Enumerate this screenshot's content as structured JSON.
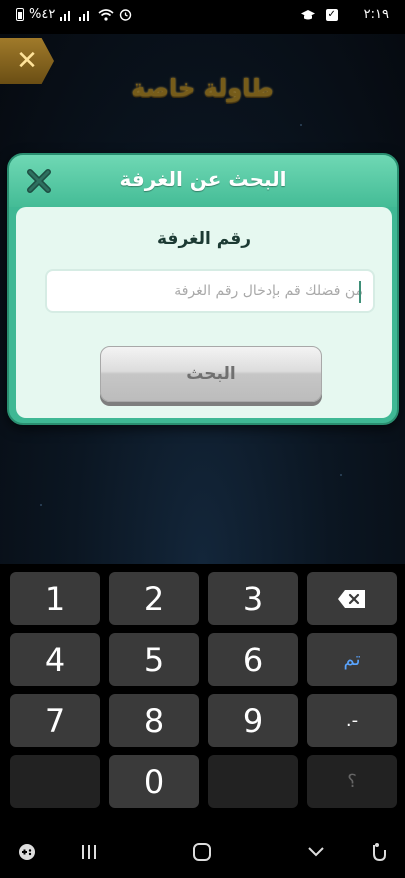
{
  "status_bar": {
    "time": "٢:١٩",
    "battery_percent": "%٤٢"
  },
  "game": {
    "title": "طاولة خاصة",
    "back_icon": "close-icon"
  },
  "dialog": {
    "title": "البحث عن الغرفة",
    "field_label": "رقم الغرفة",
    "input_placeholder": "من فضلك قم بإدخال رقم الغرفة",
    "input_value": "",
    "search_label": "البحث",
    "close_icon": "close-icon"
  },
  "keyboard": {
    "keys": [
      {
        "label": "1"
      },
      {
        "label": "2"
      },
      {
        "label": "3"
      },
      {
        "label": ""
      },
      {
        "label": "4"
      },
      {
        "label": "5"
      },
      {
        "label": "6"
      },
      {
        "label": "تم"
      },
      {
        "label": "7"
      },
      {
        "label": "8"
      },
      {
        "label": "9"
      },
      {
        "label": ".-"
      },
      {
        "label": ""
      },
      {
        "label": "0"
      },
      {
        "label": ""
      },
      {
        "label": "؟"
      }
    ],
    "done_color": "#5aa5ff"
  },
  "nav_bar": {
    "icons": [
      "gamepad-icon",
      "recent-apps-icon",
      "home-icon",
      "hide-keyboard-icon",
      "accessibility-icon"
    ]
  }
}
